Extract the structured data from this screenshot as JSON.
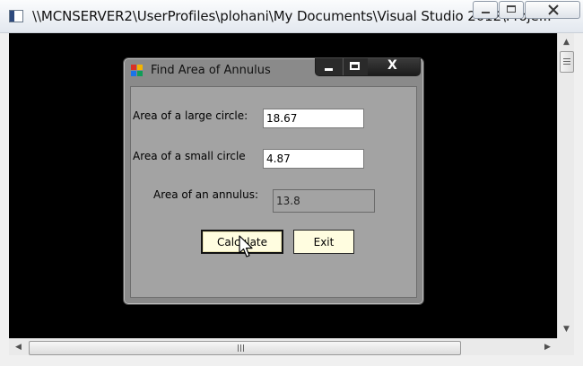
{
  "outer_window": {
    "title": "\\\\MCNSERVER2\\UserProfiles\\plohani\\My Documents\\Visual Studio 2012\\Proje...",
    "icons": [
      "console-app-icon",
      "minimize-icon",
      "maximize-icon",
      "close-icon"
    ]
  },
  "dialog": {
    "title": "Find Area of Annulus",
    "close_glyph": "X",
    "large_circle": {
      "label": "Area of a large circle:",
      "value": "18.67"
    },
    "small_circle": {
      "label": "Area of a small circle",
      "value": "4.87"
    },
    "annulus": {
      "label": "Area of an annulus:",
      "value": "13.8"
    },
    "buttons": {
      "calculate": "Calculate",
      "exit": "Exit"
    }
  },
  "colors": {
    "console_bg": "#000000",
    "form_bg": "#a3a3a3",
    "button_bg": "#fffde0"
  }
}
